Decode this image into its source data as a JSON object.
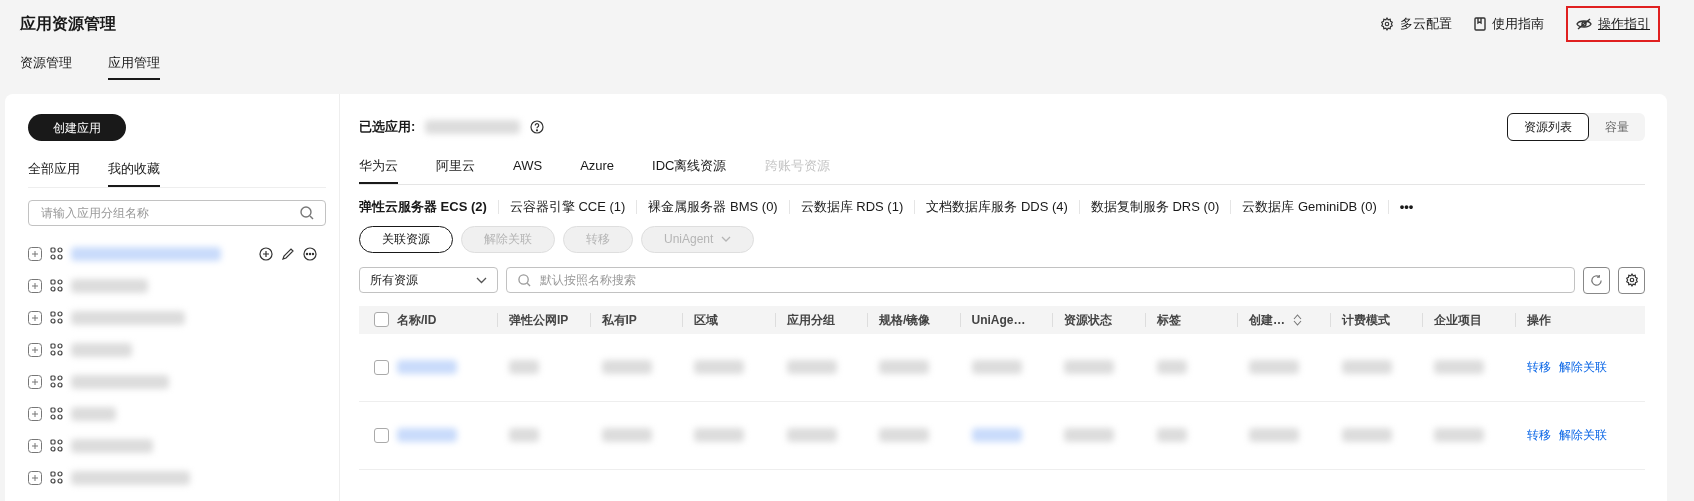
{
  "header": {
    "title": "应用资源管理",
    "links": [
      {
        "kind": "gear",
        "label": "多云配置",
        "highlighted": false
      },
      {
        "kind": "book",
        "label": "使用指南",
        "highlighted": false
      },
      {
        "kind": "eye",
        "label": "操作指引",
        "highlighted": true
      }
    ]
  },
  "main_tabs": [
    {
      "label": "资源管理",
      "selected": false
    },
    {
      "label": "应用管理",
      "selected": true
    }
  ],
  "sidebar": {
    "create_button": "创建应用",
    "tabs": [
      {
        "label": "全部应用",
        "selected": false
      },
      {
        "label": "我的收藏",
        "selected": true
      }
    ],
    "search": {
      "placeholder": "请输入应用分组名称"
    },
    "items": [
      {
        "actions": true
      },
      {
        "actions": false
      },
      {
        "actions": false
      },
      {
        "actions": false
      },
      {
        "actions": false
      },
      {
        "actions": false
      },
      {
        "actions": false
      },
      {
        "actions": false
      }
    ]
  },
  "content": {
    "selected_label": "已选应用:",
    "views": [
      {
        "label": "资源列表",
        "selected": true
      },
      {
        "label": "容量",
        "selected": false
      }
    ],
    "cloud_tabs": [
      {
        "label": "华为云",
        "selected": true,
        "disabled": false
      },
      {
        "label": "阿里云",
        "selected": false,
        "disabled": false
      },
      {
        "label": "AWS",
        "selected": false,
        "disabled": false
      },
      {
        "label": "Azure",
        "selected": false,
        "disabled": false
      },
      {
        "label": "IDC离线资源",
        "selected": false,
        "disabled": false
      },
      {
        "label": "跨账号资源",
        "selected": false,
        "disabled": true
      }
    ],
    "service_tabs": [
      {
        "label": "弹性云服务器 ECS (2)",
        "selected": true
      },
      {
        "label": "云容器引擎 CCE (1)",
        "selected": false
      },
      {
        "label": "裸金属服务器 BMS (0)",
        "selected": false
      },
      {
        "label": "云数据库 RDS (1)",
        "selected": false
      },
      {
        "label": "文档数据库服务 DDS (4)",
        "selected": false
      },
      {
        "label": "数据复制服务 DRS (0)",
        "selected": false
      },
      {
        "label": "云数据库 GeminiDB (0)",
        "selected": false
      }
    ],
    "more": "•••",
    "actions": [
      {
        "label": "关联资源",
        "disabled": false,
        "dropdown": false
      },
      {
        "label": "解除关联",
        "disabled": true,
        "dropdown": false
      },
      {
        "label": "转移",
        "disabled": true,
        "dropdown": false
      },
      {
        "label": "UniAgent",
        "disabled": true,
        "dropdown": true
      }
    ],
    "filter": {
      "value": "所有资源"
    },
    "search": {
      "placeholder": "默认按照名称搜索"
    },
    "table": {
      "select_all": {
        "checked": false
      },
      "columns": [
        {
          "label": "名称/ID",
          "sortable": false
        },
        {
          "label": "弹性公网IP",
          "sortable": false
        },
        {
          "label": "私有IP",
          "sortable": false
        },
        {
          "label": "区域",
          "sortable": false
        },
        {
          "label": "应用分组",
          "sortable": false
        },
        {
          "label": "规格/镜像",
          "sortable": false
        },
        {
          "label": "UniAge…",
          "sortable": false
        },
        {
          "label": "资源状态",
          "sortable": false
        },
        {
          "label": "标签",
          "sortable": false
        },
        {
          "label": "创建…",
          "sortable": true
        },
        {
          "label": "计费模式",
          "sortable": false
        },
        {
          "label": "企业项目",
          "sortable": false
        },
        {
          "label": "操作",
          "sortable": false
        }
      ],
      "rows": [
        {
          "checked": false,
          "actions": [
            "转移",
            "解除关联"
          ]
        },
        {
          "checked": false,
          "actions": [
            "转移",
            "解除关联"
          ]
        }
      ]
    }
  }
}
